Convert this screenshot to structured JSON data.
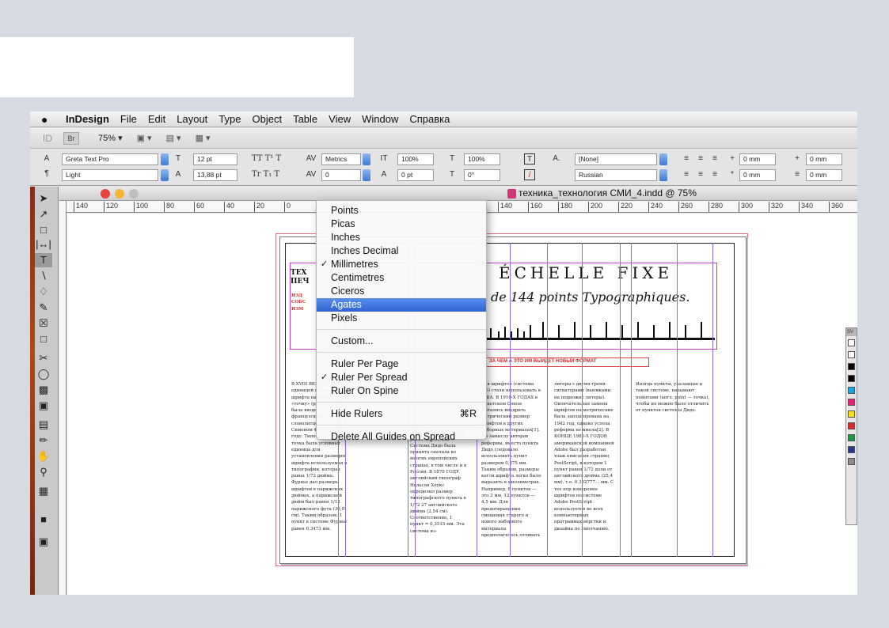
{
  "menubar": {
    "apple": "",
    "items": [
      "InDesign",
      "File",
      "Edit",
      "Layout",
      "Type",
      "Object",
      "Table",
      "View",
      "Window",
      "Справка"
    ]
  },
  "appbar": {
    "logo": "ID",
    "bridge": "Br",
    "zoom": "75% ▾",
    "view_options": "▾",
    "screen_mode": "▾",
    "arrange": "▾"
  },
  "control": {
    "font_family": "Greta Text Pro",
    "font_style": "Light",
    "font_size": "12 pt",
    "leading": "13,88 pt",
    "kerning": "Metrics",
    "tracking": "0",
    "vertical_scale": "100%",
    "horizontal_scale": "100%",
    "baseline_shift": "0 pt",
    "skew": "0°",
    "char_style": "[None]",
    "language": "Russian",
    "indent_left": "0 mm",
    "indent_first": "0 mm",
    "indent_right": "0 mm",
    "indent_last": "0 mm"
  },
  "document": {
    "title": "техника_технология СМИ_4.indd @ 75%",
    "ruler_labels": [
      "140",
      "120",
      "100",
      "80",
      "60",
      "40",
      "20",
      "0",
      "140",
      "160",
      "180",
      "200",
      "220",
      "240",
      "260",
      "280",
      "300",
      "320",
      "340",
      "360"
    ],
    "heading": "ÉCHELLE FIXE",
    "subheading": "de 144 points Typographiques.",
    "left_title": "ТЕХ\nПЕЧ",
    "red_caption": "ЗА ЧЕМ А ЭТО ИМ ВЫЙДЕТ НОВЫЙ ФОРМАТ",
    "col1": "В ХVIII ВЕКЕ типографы единицей измерения шрифта называли «точку» (point) — она была введена французским словолитцем Пьером Симоном Фурнье в 1737 году. Типографская точка была условная единица для установления размеров шрифта используемая в типографии, которая равна 1/72 дюйма. Фурнье дал размеры шрифтов в парижских дюймах, а парижский дюйм был равен 1/12 парижского фута (30,01 см). Таким образом, 1 пункт в системе Фурнье равен 0,3473 мм.",
    "col2": "ней, 0,376 мм. Система Дидо стала 1/72 дюйма равен 0,3759 мм. Система Дидо была принята сначала во многих европейских странах, в том числе и в России. В 1870 ГОДУ английский типограф Нельсон Хоукс определил размер типографского пункта в 1/72 27 английского дюйма (2,54 см). Соответственно, 1 пункт = 0,3515 мм. Эта система из-",
    "col3": "ния шрифтов (система 1/6) стали использовать в США. В 1910-Х ГОДАХ в Советском Союзе пытались внедрить метрический размер шрифтов в других наборных материалах[1]. По замыслу авторов реформы, вместо пункта Дидо следовало использовать пункт размером 0,375 мм. Таким образом, размеры кегля шрифта легко было выразить в миллиметрах. Например, 8 пунктов — это 3 мм, 12 пунктов — 4,5 мм. Для предотвращения смешения старого и нового наборного материала предполагалось отливать",
    "col4": "литеры с двумя-тремя сигнатурами (выемками на подножке литеры). Окончательная замена шрифтов на метрические была запланирована на 1942 год, однако успеха реформа не имела[2]. В КОНЦЕ 1980-Х ГОДОВ американской компанией Adobe был разработан язык описания страниц PostScript, в котором 1 пункт равен 1/72 доли от английского дюйма (25,4 мм), т.е. 0,352777... мм. С тех пор измерение шрифтов по системе Adobe PostScript используется во всех компьютерных программах вёрстки и дизайна по умолчанию.",
    "col5": "Иногда пункты, указанные в такой системе, называют пойнтами (англ. point — точка), чтобы их можно было отличить от пунктов системы Дидо."
  },
  "ruler_menu": {
    "units": [
      {
        "label": "Points",
        "checked": false
      },
      {
        "label": "Picas",
        "checked": false
      },
      {
        "label": "Inches",
        "checked": false
      },
      {
        "label": "Inches Decimal",
        "checked": false
      },
      {
        "label": "Millimetres",
        "checked": true
      },
      {
        "label": "Centimetres",
        "checked": false
      },
      {
        "label": "Ciceros",
        "checked": false
      },
      {
        "label": "Agates",
        "checked": false,
        "highlighted": true
      },
      {
        "label": "Pixels",
        "checked": false
      }
    ],
    "custom": "Custom...",
    "origin": [
      {
        "label": "Ruler Per Page",
        "checked": false
      },
      {
        "label": "Ruler Per Spread",
        "checked": true
      },
      {
        "label": "Ruler On Spine",
        "checked": false
      }
    ],
    "hide_rulers": "Hide Rulers",
    "hide_rulers_shortcut": "⌘R",
    "delete_guides": "Delete All Guides on Spread",
    "check_mark": "✓"
  },
  "swatches": {
    "header": "SV",
    "colors": [
      "#ffffff",
      "#ffffff",
      "#000000",
      "#000000",
      "#1aa6e0",
      "#e2237b",
      "#f4e21e",
      "#d72a2a",
      "#1a9a44",
      "#27348b",
      "#8c8c8c"
    ]
  }
}
